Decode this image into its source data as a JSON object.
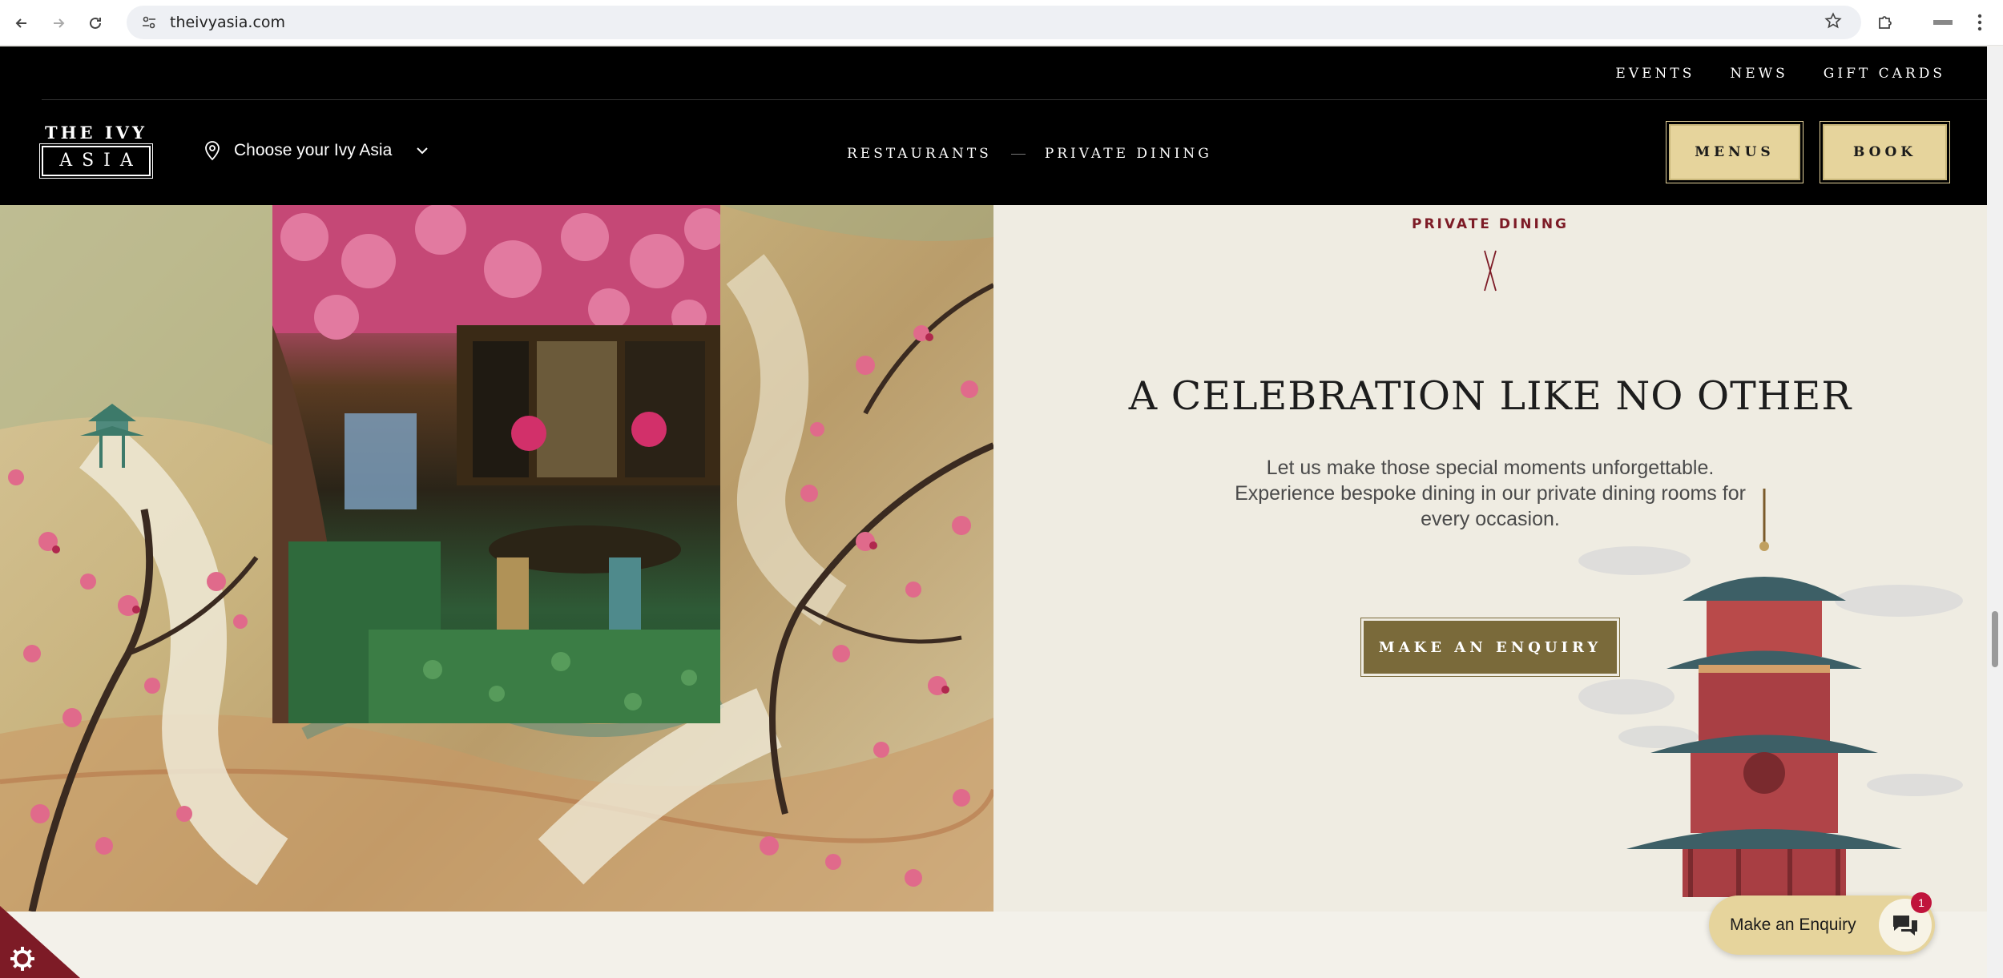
{
  "browser": {
    "url": "theivyasia.com",
    "back_icon": "arrow-left-icon",
    "forward_icon": "arrow-right-icon",
    "reload_icon": "reload-icon",
    "bookmark_icon": "star-icon",
    "extensions_icon": "puzzle-icon",
    "menu_icon": "kebab-icon"
  },
  "header": {
    "top_links": [
      "EVENTS",
      "NEWS",
      "GIFT CARDS"
    ],
    "logo_top": "THE IVY",
    "logo_bottom": "ASIA",
    "location_label": "Choose your Ivy Asia",
    "center_links": [
      "RESTAURANTS",
      "PRIVATE DINING"
    ],
    "menus_label": "MENUS",
    "book_label": "BOOK"
  },
  "hero": {
    "section_label": "PRIVATE DINING",
    "headline": "A CELEBRATION LIKE NO OTHER",
    "lede": "Let us make those special moments unforgettable. Experience bespoke dining in our private dining rooms for every occasion.",
    "cta_label": "MAKE AN ENQUIRY"
  },
  "chat": {
    "label": "Make an Enquiry",
    "badge_count": "1"
  },
  "colors": {
    "header_bg": "#000000",
    "gold": "#e6d49c",
    "olive_cta": "#7a6a3a",
    "burgundy": "#7d1b26",
    "cream": "#efece2"
  }
}
